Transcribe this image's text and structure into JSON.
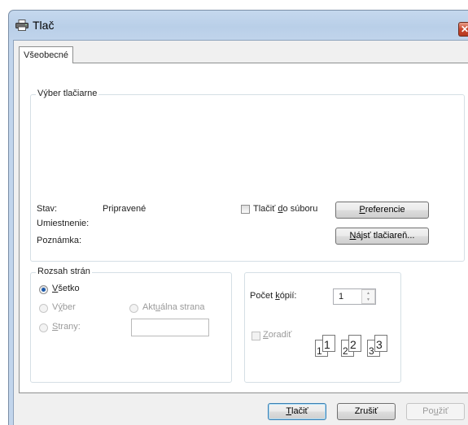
{
  "window": {
    "title": "Tlač",
    "close_glyph": "✕"
  },
  "tabs": [
    {
      "label": "Všeobecné"
    }
  ],
  "printer_group": {
    "label": "Výber tlačiarne",
    "status_label": "Stav:",
    "status_value": "Pripravené",
    "location_label": "Umiestnenie:",
    "location_value": "",
    "comment_label": "Poznámka:",
    "comment_value": "",
    "print_to_file": {
      "label_pre": "Tlačiť ",
      "label_accel": "d",
      "label_post": "o súboru",
      "checked": false
    },
    "preferences_button": {
      "accel": "P",
      "rest": "referencie"
    },
    "find_printer_button": {
      "accel": "N",
      "rest": "ájsť tlačiareň..."
    }
  },
  "page_range": {
    "label": "Rozsah strán",
    "all": {
      "accel": "V",
      "rest": "šetko",
      "selected": true
    },
    "selection": {
      "pre": "V",
      "accel": "ý",
      "rest": "ber",
      "enabled": false
    },
    "current_page": {
      "pre": "Akt",
      "accel": "u",
      "rest": "álna strana",
      "enabled": false
    },
    "pages": {
      "accel": "S",
      "rest": "trany:",
      "value": ""
    }
  },
  "copies": {
    "label_pre": "Počet ",
    "label_accel": "k",
    "label_post": "ópií:",
    "value": "1",
    "collate": {
      "accel": "Z",
      "rest": "oradiť",
      "enabled": false
    },
    "collate_pages": [
      {
        "back": "1",
        "front": "1"
      },
      {
        "back": "2",
        "front": "2"
      },
      {
        "back": "3",
        "front": "3"
      }
    ]
  },
  "buttons": {
    "print": {
      "accel": "T",
      "rest": "lačiť"
    },
    "cancel": {
      "label": "Zrušiť"
    },
    "apply": {
      "pre": "Po",
      "accel": "u",
      "rest": "žiť"
    }
  },
  "icons": {
    "title": "printer-icon",
    "close": "close-icon",
    "spin_up": "▲",
    "spin_down": "▼"
  }
}
